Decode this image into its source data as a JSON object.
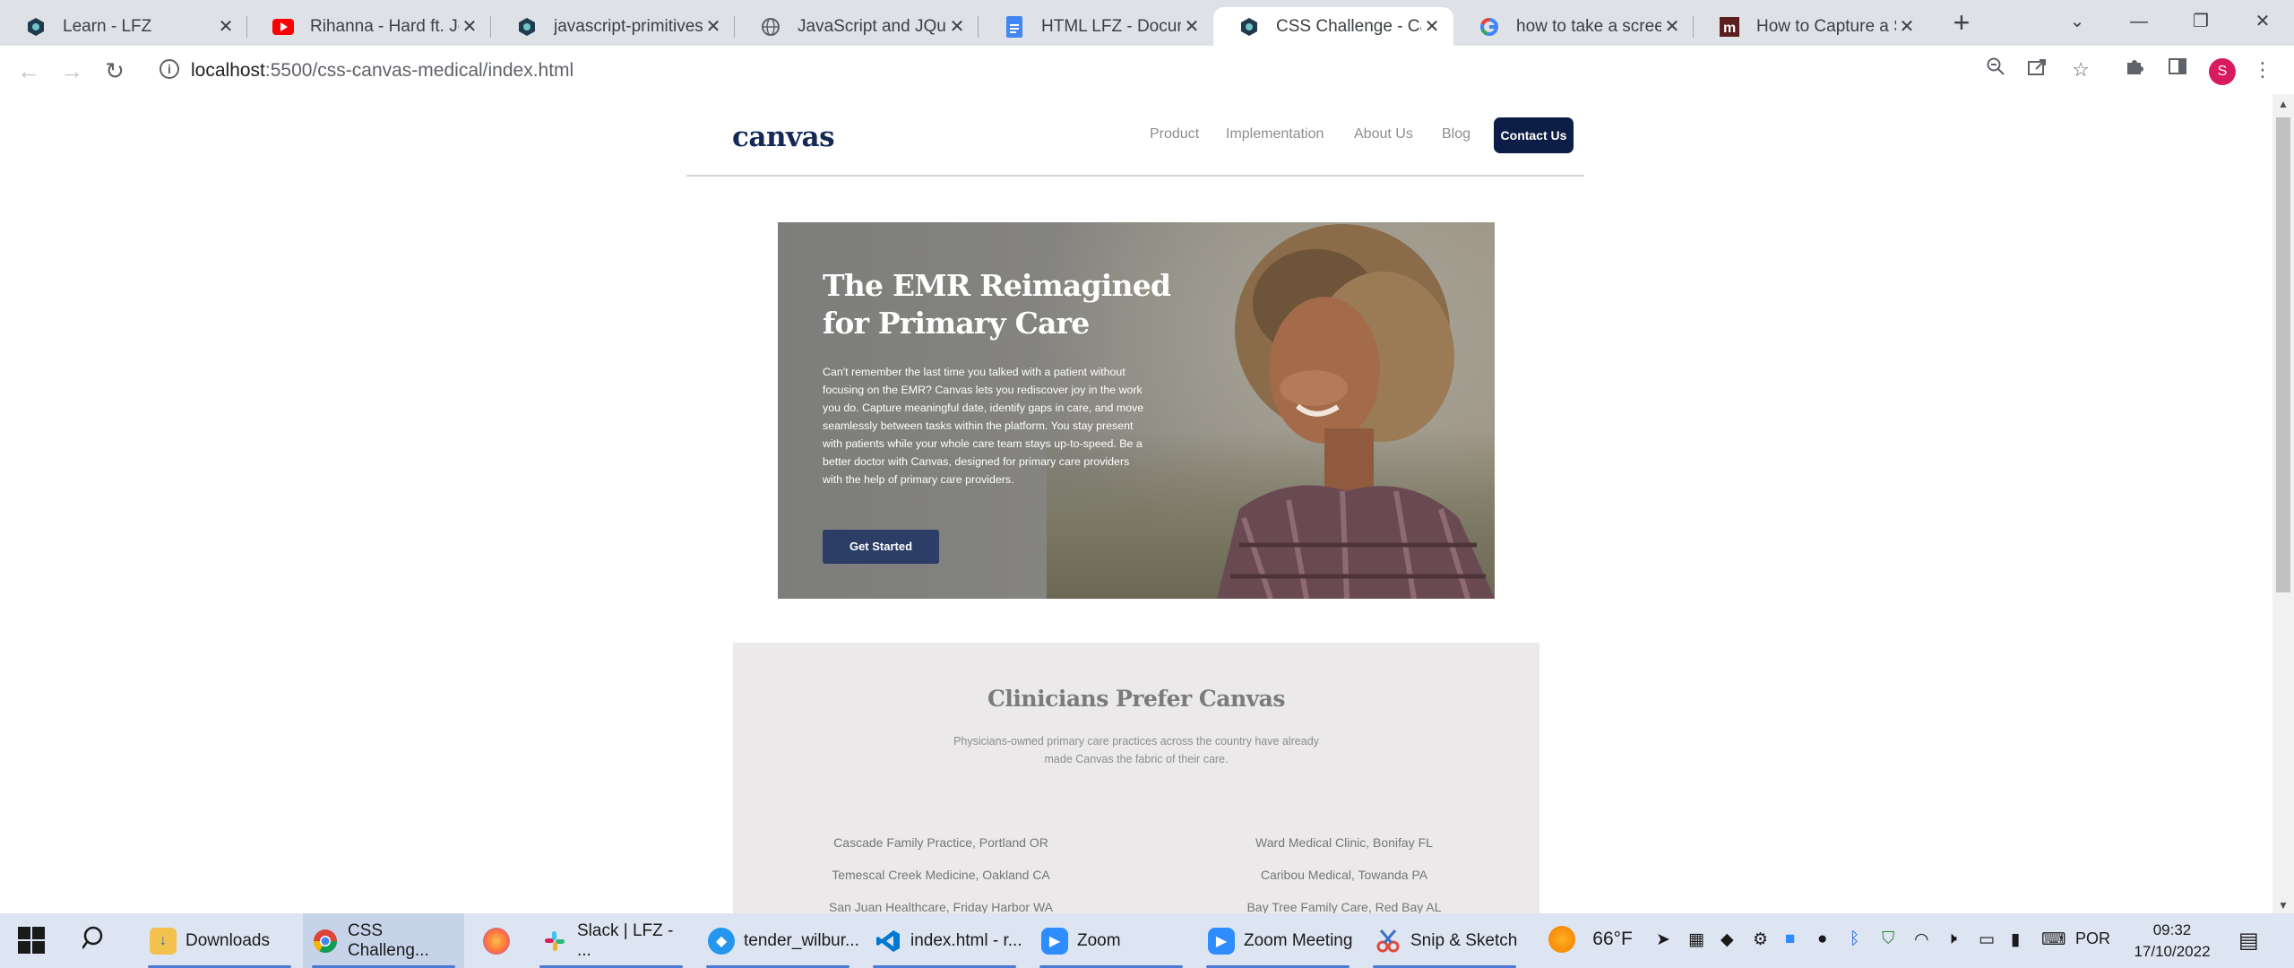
{
  "browser": {
    "tabs": [
      {
        "title": "Learn - LFZ",
        "icon": "lfz-logo-icon"
      },
      {
        "title": "Rihanna - Hard ft. Jeezy",
        "icon": "youtube-icon"
      },
      {
        "title": "javascript-primitives-and-variables",
        "icon": "lfz-logo-icon"
      },
      {
        "title": "JavaScript and JQuery",
        "icon": "globe-icon"
      },
      {
        "title": "HTML LFZ - Documento",
        "icon": "google-docs-icon"
      },
      {
        "title": "CSS Challenge - Canvas",
        "icon": "lfz-logo-icon"
      },
      {
        "title": "how to take a screenshot",
        "icon": "google-icon"
      },
      {
        "title": "How to Capture a Screenshot",
        "icon": "medium-icon"
      }
    ],
    "url_host": "localhost",
    "url_path": ":5500/css-canvas-medical/index.html",
    "profile_initial": "S"
  },
  "site": {
    "logo": "canvas",
    "nav": [
      "Product",
      "Implementation",
      "About Us",
      "Blog"
    ],
    "contact_label": "Contact Us",
    "hero": {
      "title": "The EMR Reimagined for Primary Care",
      "body": "Can't remember the last time you talked with a patient without focusing on the EMR? Canvas lets you rediscover joy in the work you do. Capture meaningful date, identify gaps in care, and move seamlessly between tasks within the platform. You stay present with patients while your whole care team stays up-to-speed. Be a better doctor with Canvas, designed for primary care providers with the help of primary care providers.",
      "cta": "Get Started"
    },
    "clinicians": {
      "title": "Clinicians Prefer Canvas",
      "subtitle": "Physicians-owned primary care practices across the country have already made Canvas the fabric of their care.",
      "left": [
        "Cascade Family Practice, Portland OR",
        "Temescal Creek Medicine, Oakland CA",
        "San Juan Healthcare, Friday Harbor WA"
      ],
      "right": [
        "Ward Medical Clinic, Bonifay FL",
        "Caribou Medical, Towanda PA",
        "Bay Tree Family Care, Red Bay AL"
      ]
    }
  },
  "taskbar": {
    "apps": [
      {
        "label": "Downloads",
        "icon": "folder-icon"
      },
      {
        "label": "CSS Challeng...",
        "icon": "chrome-icon"
      },
      {
        "label": "",
        "icon": "firefox-icon"
      },
      {
        "label": "Slack | LFZ - ...",
        "icon": "slack-icon"
      },
      {
        "label": "tender_wilbur...",
        "icon": "docker-icon"
      },
      {
        "label": "index.html - r...",
        "icon": "vscode-icon"
      },
      {
        "label": "Zoom",
        "icon": "zoom-icon"
      },
      {
        "label": "Zoom Meeting",
        "icon": "zoom-icon"
      },
      {
        "label": "Snip & Sketch",
        "icon": "snip-sketch-icon"
      }
    ],
    "weather": "66°F",
    "language": "POR",
    "time": "09:32",
    "date": "17/10/2022"
  },
  "colors": {
    "brand_navy": "#0c1e46",
    "hero_button": "#2c3d66",
    "chrome_frame": "#dee1e6",
    "taskbar": "#dde5f2",
    "profile": "#d81b60"
  }
}
